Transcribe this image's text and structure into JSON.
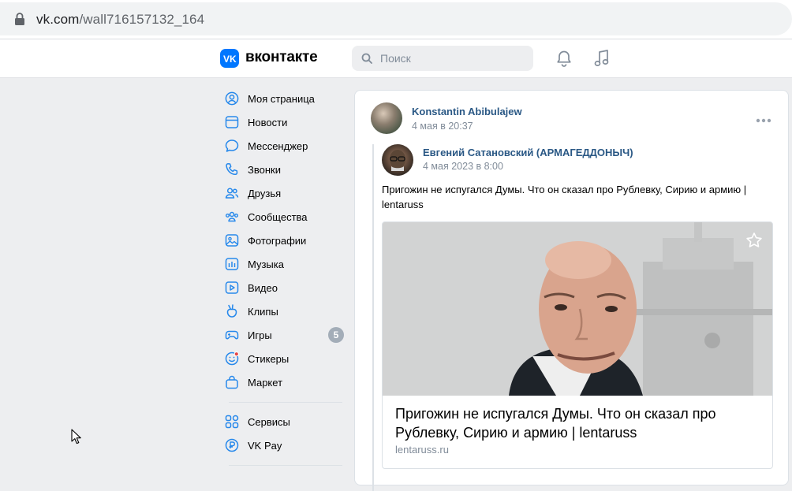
{
  "browser": {
    "url_host": "vk.com",
    "url_path": "/wall716157132_164"
  },
  "header": {
    "logo_text": "вконтакте",
    "search_placeholder": "Поиск",
    "accent": "#0077ff"
  },
  "sidebar": {
    "items": [
      {
        "label": "Моя страница",
        "icon": "user-circle-icon"
      },
      {
        "label": "Новости",
        "icon": "news-icon"
      },
      {
        "label": "Мессенджер",
        "icon": "message-icon"
      },
      {
        "label": "Звонки",
        "icon": "phone-icon"
      },
      {
        "label": "Друзья",
        "icon": "friends-icon"
      },
      {
        "label": "Сообщества",
        "icon": "communities-icon"
      },
      {
        "label": "Фотографии",
        "icon": "photo-icon"
      },
      {
        "label": "Музыка",
        "icon": "music-icon"
      },
      {
        "label": "Видео",
        "icon": "video-icon"
      },
      {
        "label": "Клипы",
        "icon": "clips-icon"
      },
      {
        "label": "Игры",
        "icon": "games-icon",
        "badge": "5"
      },
      {
        "label": "Стикеры",
        "icon": "stickers-icon"
      },
      {
        "label": "Маркет",
        "icon": "market-icon"
      }
    ],
    "items2": [
      {
        "label": "Сервисы",
        "icon": "services-icon"
      },
      {
        "label": "VK Pay",
        "icon": "vkpay-icon"
      }
    ]
  },
  "post": {
    "author": "Konstantin Abibulajew",
    "date": "4 мая в 20:37",
    "repost": {
      "author": "Евгений Сатановский (АРМАГЕДДОНЫЧ)",
      "date": "4 мая 2023 в 8:00",
      "text": "Пригожин не испугался Думы. Что он сказал про Рублевку, Сирию и армию | lentaruss",
      "link": {
        "title": "Пригожин не испугался Думы. Что он сказал про Рублевку, Сирию и армию | lentaruss",
        "source": "lentaruss.ru"
      }
    }
  }
}
